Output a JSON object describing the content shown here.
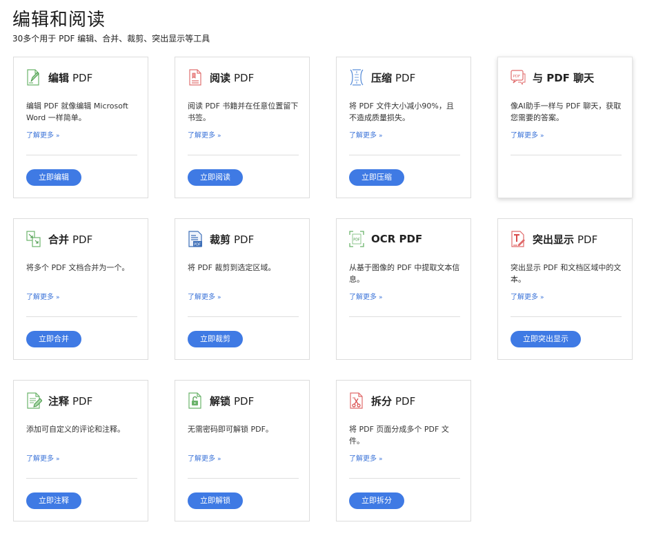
{
  "header": {
    "title": "编辑和阅读",
    "subtitle": "30多个用于 PDF 编辑、合并、裁剪、突出显示等工具"
  },
  "colors": {
    "accent": "#3f7ae4",
    "link": "#3b73d8",
    "border": "#dcdcdc"
  },
  "learn_more_label": "了解更多",
  "cards": [
    {
      "title": "编辑",
      "title_suffix": "PDF",
      "icon": "edit-pdf-icon",
      "desc": "编辑 PDF 就像编辑 Microsoft Word 一样简单。",
      "button": "立即编辑"
    },
    {
      "title": "阅读",
      "title_suffix": "PDF",
      "icon": "read-pdf-icon",
      "desc": "阅读 PDF 书籍并在任意位置留下书签。",
      "button": "立即阅读"
    },
    {
      "title": "压缩",
      "title_suffix": "PDF",
      "icon": "compress-pdf-icon",
      "desc": "将 PDF 文件大小减小90%，且不造成质量损失。",
      "button": "立即压缩"
    },
    {
      "title": "与 PDF 聊天",
      "title_suffix": "",
      "icon": "chat-pdf-icon",
      "desc": "像AI助手一样与 PDF 聊天，获取您需要的答案。",
      "button": ""
    },
    {
      "title": "合并",
      "title_suffix": "PDF",
      "icon": "merge-pdf-icon",
      "desc": "将多个 PDF 文档合并为一个。",
      "button": "立即合并"
    },
    {
      "title": "裁剪",
      "title_suffix": "PDF",
      "icon": "crop-pdf-icon",
      "desc": "将 PDF 裁剪到选定区域。",
      "button": "立即裁剪"
    },
    {
      "title": "OCR PDF",
      "title_suffix": "",
      "icon": "ocr-pdf-icon",
      "desc": "从基于图像的 PDF 中提取文本信息。",
      "button": ""
    },
    {
      "title": "突出显示",
      "title_suffix": "PDF",
      "icon": "highlight-pdf-icon",
      "desc": "突出显示 PDF 和文档区域中的文本。",
      "button": "立即突出显示"
    },
    {
      "title": "注释",
      "title_suffix": "PDF",
      "icon": "annotate-pdf-icon",
      "desc": "添加可自定义的评论和注释。",
      "button": "立即注释"
    },
    {
      "title": "解锁",
      "title_suffix": "PDF",
      "icon": "unlock-pdf-icon",
      "desc": "无需密码即可解锁 PDF。",
      "button": "立即解锁"
    },
    {
      "title": "拆分",
      "title_suffix": "PDF",
      "icon": "split-pdf-icon",
      "desc": "将 PDF 页面分成多个 PDF 文件。",
      "button": "立即拆分"
    }
  ]
}
